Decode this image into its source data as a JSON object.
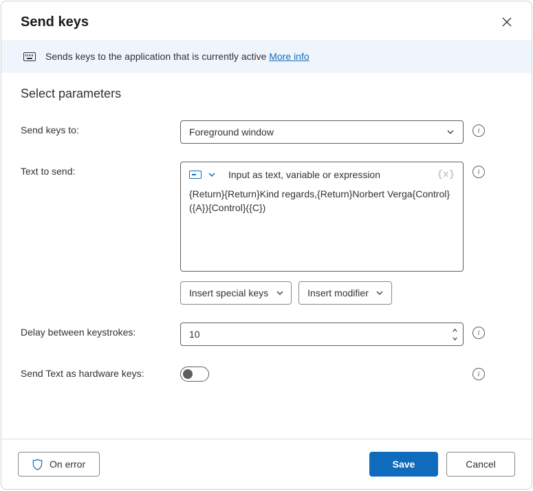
{
  "header": {
    "title": "Send keys"
  },
  "banner": {
    "text": "Sends keys to the application that is currently active ",
    "more_info": "More info"
  },
  "section_title": "Select parameters",
  "fields": {
    "send_keys_to": {
      "label": "Send keys to:",
      "value": "Foreground window"
    },
    "text_to_send": {
      "label": "Text to send:",
      "placeholder": "Input as text, variable or expression",
      "value": "{Return}{Return}Kind regards,{Return}Norbert Verga{Control}({A}){Control}({C})",
      "insert_special": "Insert special keys",
      "insert_modifier": "Insert modifier"
    },
    "delay": {
      "label": "Delay between keystrokes:",
      "value": "10"
    },
    "hardware": {
      "label": "Send Text as hardware keys:",
      "enabled": false
    }
  },
  "footer": {
    "on_error": "On error",
    "save": "Save",
    "cancel": "Cancel"
  }
}
